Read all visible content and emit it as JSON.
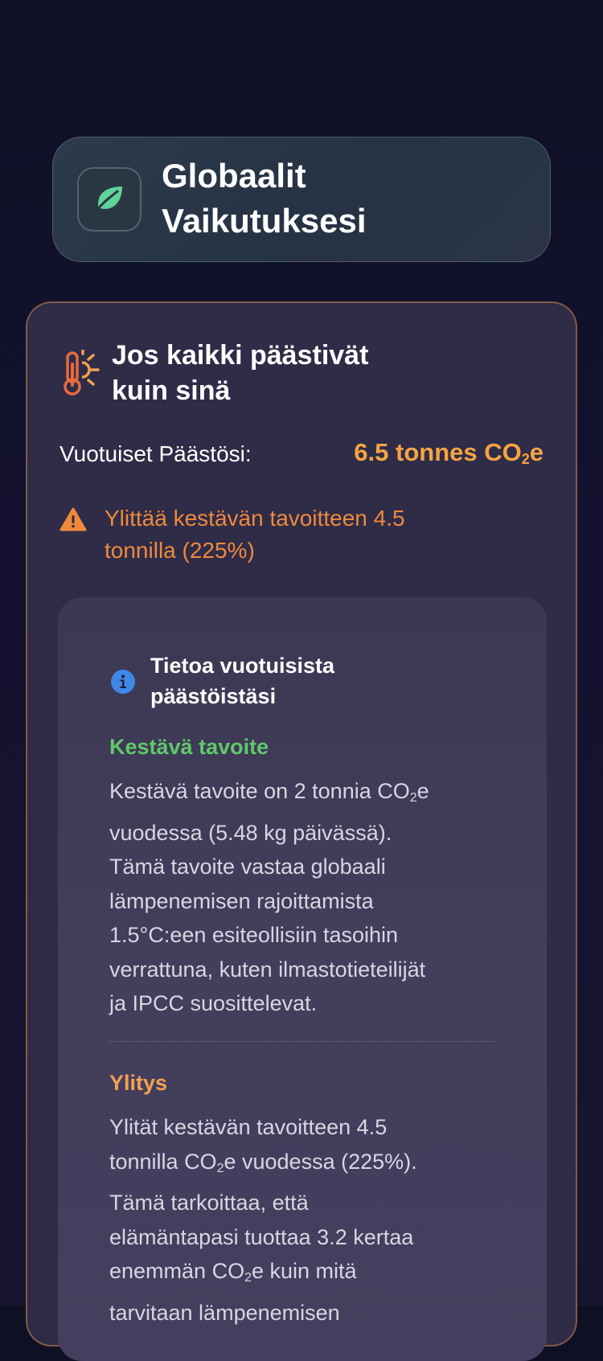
{
  "header": {
    "title_line1": "Globaalit",
    "title_line2": "Vaikutuksesi",
    "icon": "leaf-icon"
  },
  "impact": {
    "icon": "hot-thermometer-icon",
    "title_line1": "Jos kaikki päästivät",
    "title_line2": "kuin sinä",
    "emissions_label": "Vuotuiset Päästösi:",
    "emissions_value_main": "6.5 tonnes CO",
    "emissions_value_sub": "2",
    "emissions_value_end": "e",
    "warning_icon": "warning-triangle-icon",
    "warning_line1": "Ylittää kestävän tavoitteen 4.5",
    "warning_line2": "tonnilla (225%)"
  },
  "info": {
    "icon": "info-icon",
    "title_line1": "Tietoa vuotuisista",
    "title_line2": "päästöistäsi",
    "sustainable": {
      "heading": "Kestävä tavoite",
      "p1": "Kestävä tavoite on 2 tonnia CO",
      "p1_sub": "2",
      "p1_end": "e",
      "p2": "vuodessa (5.48 kg päivässä).",
      "p3": "Tämä tavoite vastaa globaali",
      "p4": "lämpenemisen rajoittamista",
      "p5": "1.5°C:een esiteollisiin tasoihin",
      "p6": "verrattuna, kuten ilmastotieteilijät",
      "p7": "ja IPCC suosittelevat."
    },
    "exceed": {
      "heading": "Ylitys",
      "l1": "Ylität kestävän tavoitteen 4.5",
      "l2a": "tonnilla CO",
      "l2_sub": "2",
      "l2b": "e vuodessa (225%).",
      "l3": "Tämä tarkoittaa, että",
      "l4": "elämäntapasi tuottaa 3.2 kertaa",
      "l5a": "enemmän CO",
      "l5_sub": "2",
      "l5b": "e kuin mitä",
      "l6": "tarvitaan lämpenemisen"
    }
  },
  "colors": {
    "accent_orange": "#f5a443",
    "warning_orange": "#f0893b",
    "sustainable_green": "#5fc96a",
    "exceed_orange": "#f0a150",
    "info_blue": "#3f87e8",
    "leaf_green": "#5fd39a"
  }
}
